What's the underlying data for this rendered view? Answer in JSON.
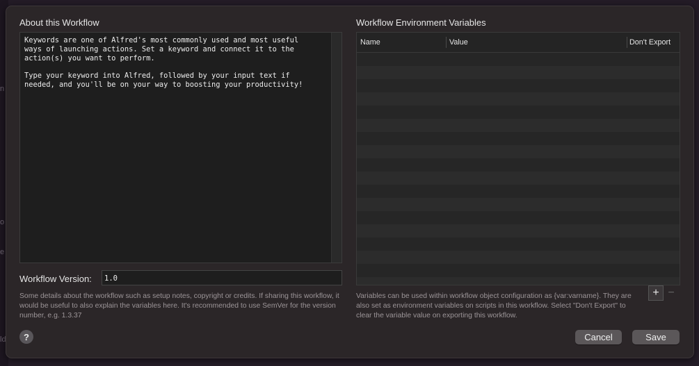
{
  "background_window": {
    "edge_glyphs": [
      "n",
      "o",
      "e",
      "ld"
    ]
  },
  "about": {
    "heading": "About this Workflow",
    "body_text": "Keywords are one of Alfred's most commonly used and most useful\nways of launching actions. Set a keyword and connect it to the\naction(s) you want to perform.\n\nType your keyword into Alfred, followed by your input text if\nneeded, and you'll be on your way to boosting your productivity!"
  },
  "version": {
    "label": "Workflow Version:",
    "value": "1.0"
  },
  "helper_left": "Some details about the workflow such as setup notes, copyright or credits. If sharing this workflow, it would be useful to also explain the variables here. It's recommended to use SemVer for the version number, e.g. 1.3.37",
  "env": {
    "heading": "Workflow Environment Variables",
    "columns": [
      "Name",
      "Value",
      "Don't Export"
    ],
    "rows": []
  },
  "helper_right": "Variables can be used within workflow object configuration as {var:varname}. They are also set as environment variables on scripts in this workflow. Select \"Don't Export\" to clear the variable value on exporting this workflow.",
  "controls": {
    "add_glyph": "+",
    "remove_glyph": "−",
    "help_glyph": "?",
    "cancel_label": "Cancel",
    "save_label": "Save"
  },
  "icons": [
    "help-icon",
    "add-icon",
    "remove-icon"
  ],
  "colors": {
    "sheet_bg": "#2b2628",
    "field_bg": "#1e1e1e",
    "button_bg": "#5b5759",
    "helper_text": "#9c9598"
  }
}
